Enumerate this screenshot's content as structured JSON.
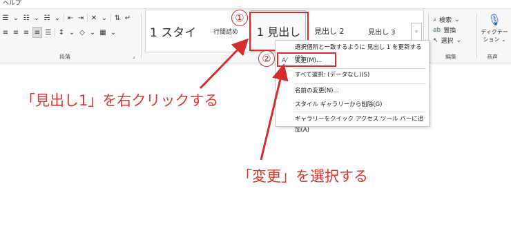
{
  "menubar": {
    "help": "ヘルプ"
  },
  "ribbon": {
    "paragraph_label": "段落",
    "editing_label": "編集",
    "voice_label": "音声",
    "find": "検索",
    "replace": "置換",
    "select": "選択",
    "dictate_line1": "ディクテー",
    "dictate_line2": "ション"
  },
  "styles": {
    "items": [
      {
        "label": "1 スタイ"
      },
      {
        "label": "行間詰め"
      },
      {
        "label": "1 見出し"
      },
      {
        "label": "見出し 2"
      },
      {
        "label": "見出し 3"
      }
    ]
  },
  "context_menu": {
    "items": [
      {
        "label": "選択個所と一致するように 見出し 1 を更新する(P)"
      },
      {
        "label": "変更(M)..."
      },
      {
        "label": "すべて選択: (データなし)(S)"
      },
      {
        "label": "名前の変更(N)..."
      },
      {
        "label": "スタイル ギャラリーから削除(G)"
      },
      {
        "label": "ギャラリーをクイック アクセス ツール バーに追加(A)"
      }
    ]
  },
  "annotations": {
    "step1": "①",
    "step2": "②",
    "callout1": "「見出し1」を右クリックする",
    "callout2": "「変更」を選択する"
  },
  "colors": {
    "accent_red": "#d62d2d",
    "callout_red": "#e0362b"
  }
}
